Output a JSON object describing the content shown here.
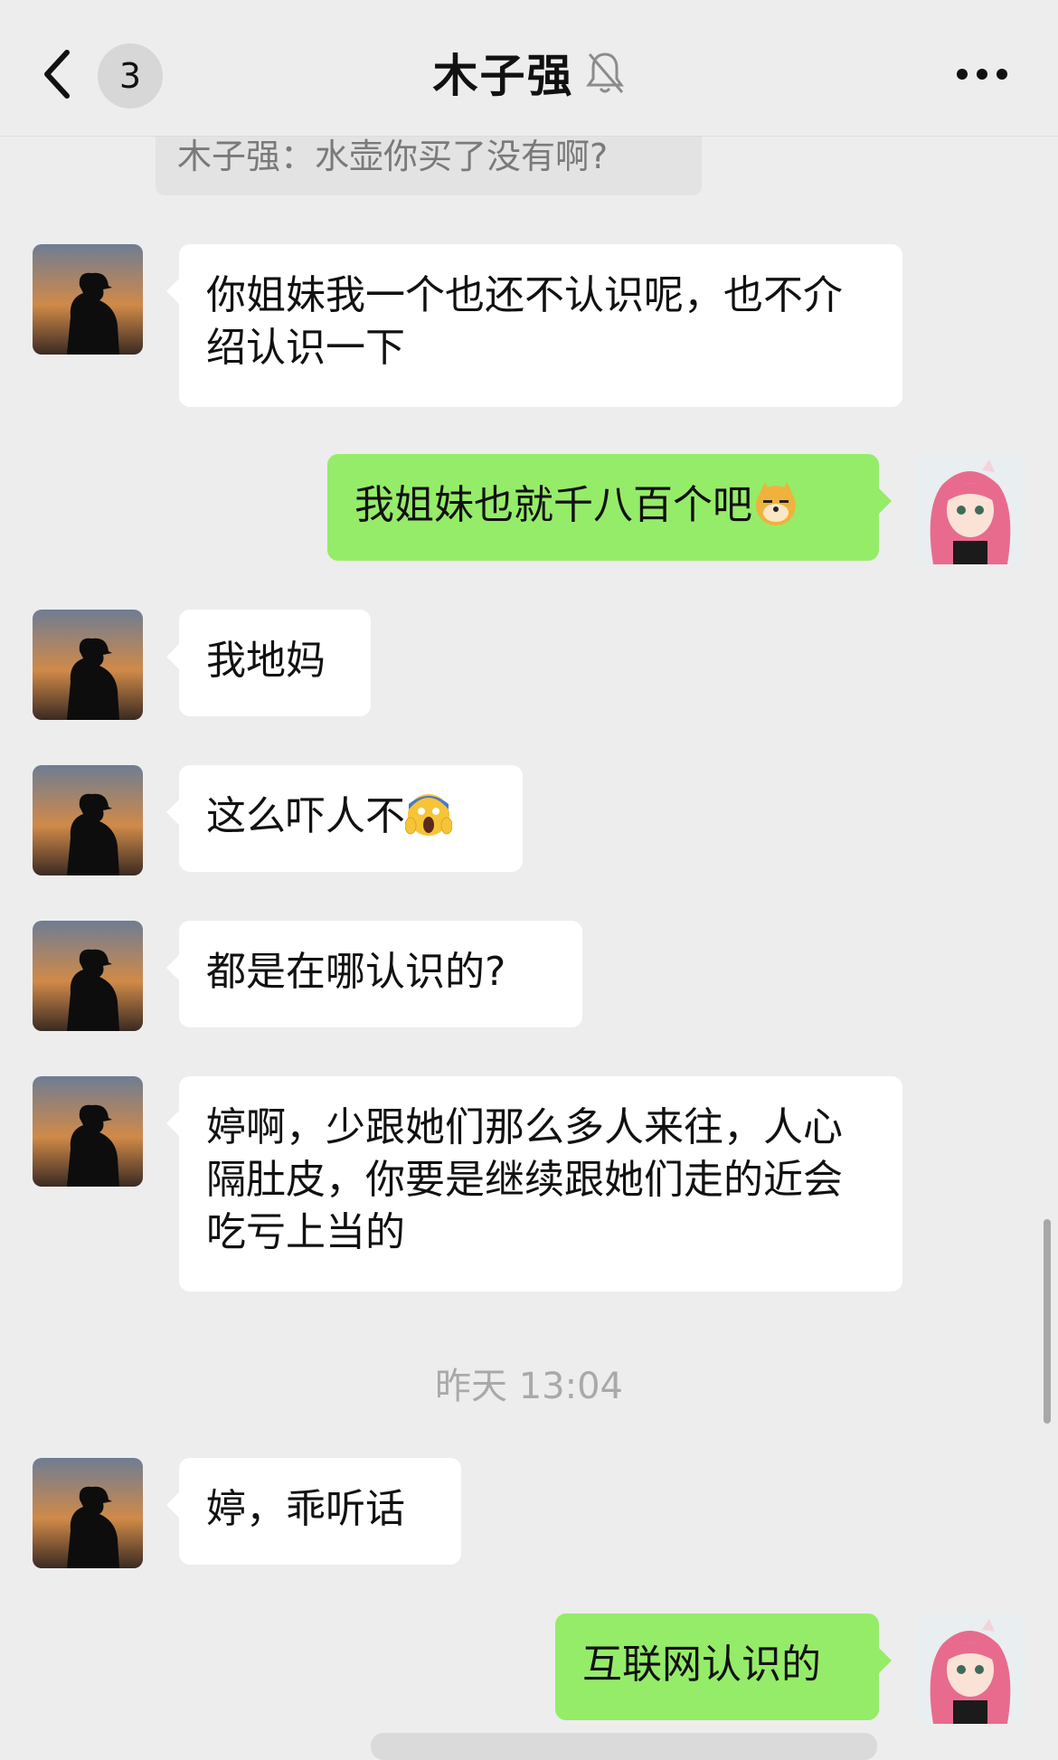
{
  "header": {
    "back_label": "<",
    "unread_count": "3",
    "title": "木子强",
    "more_label": "...",
    "icons": [
      "chevron-left-icon",
      "bell-muted-icon",
      "more-dots-icon"
    ]
  },
  "quote": {
    "text": "木子强：水壶你买了没有啊?"
  },
  "messages": [
    {
      "side": "in",
      "text": "你姐妹我一个也还不认识呢，也不介绍认识一下"
    },
    {
      "side": "out",
      "text": "我姐妹也就千八百个吧",
      "emoji": "doge-icon"
    },
    {
      "side": "in",
      "text": "我地妈"
    },
    {
      "side": "in",
      "text": "这么吓人不",
      "emoji": "scream-icon"
    },
    {
      "side": "in",
      "text": "都是在哪认识的?"
    },
    {
      "side": "in",
      "text": "婷啊，少跟她们那么多人来往，人心隔肚皮，你要是继续跟她们走的近会吃亏上当的"
    },
    {
      "side": "in",
      "text": "婷，乖听话"
    },
    {
      "side": "out",
      "text": "互联网认识的"
    }
  ],
  "timestamp": "昨天 13:04",
  "colors": {
    "background": "#EDEDED",
    "incoming_bubble": "#FFFFFF",
    "outgoing_bubble": "#95EC69",
    "timestamp_text": "#A9A9A9"
  }
}
